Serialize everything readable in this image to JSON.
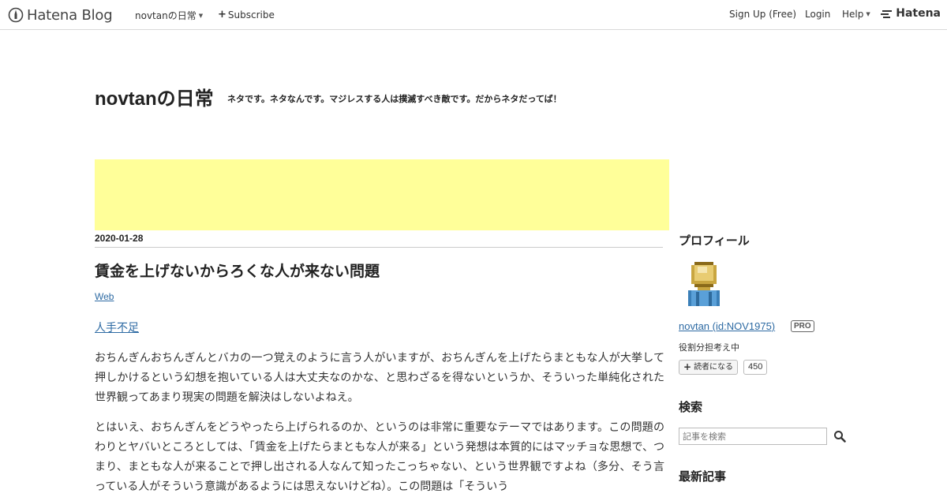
{
  "header": {
    "logo_text": "Hatena Blog",
    "blog_menu": "novtanの日常",
    "subscribe": "Subscribe",
    "signup": "Sign Up (Free)",
    "login": "Login",
    "help": "Help",
    "hatena": "Hatena"
  },
  "blog": {
    "title": "novtanの日常",
    "description": "ネタです。ネタなんです。マジレスする人は撲滅すべき敵です。だからネタだってば！"
  },
  "ad": {
    "color": "#ffff99"
  },
  "entry": {
    "date": "2020-01-28",
    "title": "賃金を上げないからろくな人が来ない問題",
    "category": "Web",
    "link_text": "人手不足",
    "paragraphs": [
      "おちんぎんおちんぎんとバカの一つ覚えのように言う人がいますが、おちんぎんを上げたらまともな人が大挙して押しかけるという幻想を抱いている人は大丈夫なのかな、と思わざるを得ないというか、そういった単純化された世界観ってあまり現実の問題を解決はしないよねえ。",
      "とはいえ、おちんぎんをどうやったら上げられるのか、というのは非常に重要なテーマではあります。この問題のわりとヤバいところとしては、「賃金を上げたらまともな人が来る」という発想は本質的にはマッチョな思想で、つまり、まともな人が来ることで押し出される人なんて知ったこっちゃない、という世界観ですよね（多分、そう言っている人がそういう意識があるようには思えないけどね）。この問題は「そういう"
    ]
  },
  "sidebar": {
    "profile_heading": "プロフィール",
    "profile_name": "novtan (id:NOV1975)",
    "pro_badge": "PRO",
    "profile_desc": "役割分担考え中",
    "subscribe_label": "読者になる",
    "subscriber_count": "450",
    "search_heading": "検索",
    "search_placeholder": "記事を検索",
    "recent_heading": "最新記事"
  },
  "colors": {
    "link": "#2d6aa3",
    "border": "#d9d9d9"
  }
}
